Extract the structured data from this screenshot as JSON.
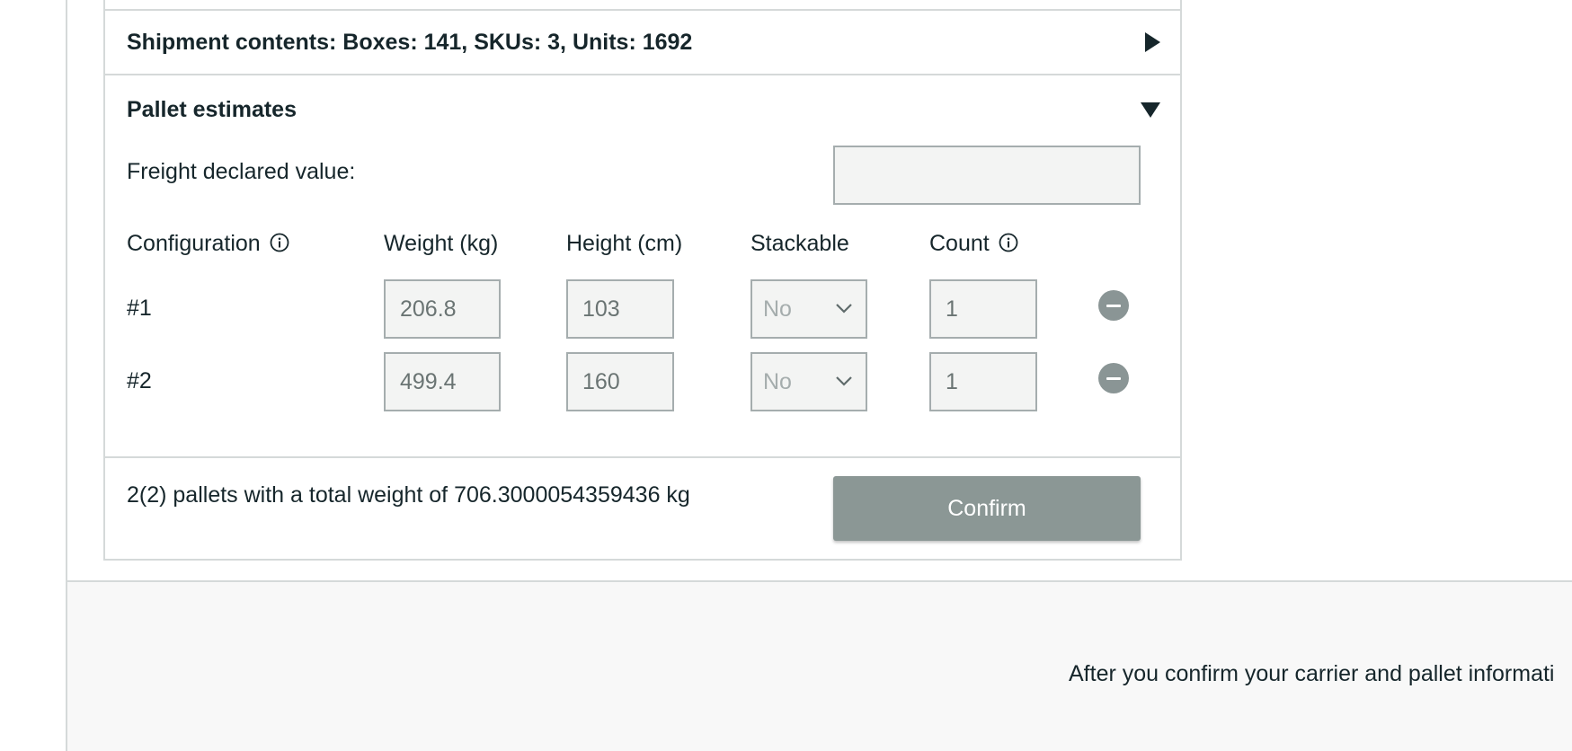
{
  "shipment_contents": {
    "title": "Shipment contents: Boxes: 141, SKUs: 3, Units: 1692",
    "expanded": false
  },
  "pallet_estimates": {
    "title": "Pallet estimates",
    "expanded": true,
    "freight_label": "Freight declared value:",
    "freight_value": "",
    "columns": {
      "configuration": "Configuration",
      "weight": "Weight (kg)",
      "height": "Height (cm)",
      "stackable": "Stackable",
      "count": "Count"
    },
    "rows": [
      {
        "label": "#1",
        "weight": "206.8",
        "height": "103",
        "stackable": "No",
        "count": "1"
      },
      {
        "label": "#2",
        "weight": "499.4",
        "height": "160",
        "stackable": "No",
        "count": "1"
      }
    ],
    "summary": "2(2) pallets with a total weight of 706.3000054359436 kg",
    "confirm_label": "Confirm"
  },
  "footer": {
    "text": "After you confirm your carrier and pallet informati"
  },
  "icons": {
    "info": "info-circle-icon",
    "remove": "minus-circle-icon",
    "collapsed": "triangle-right-icon",
    "expanded": "triangle-down-icon",
    "dropdown": "chevron-down-icon"
  },
  "colors": {
    "text": "#16262b",
    "border": "#d5d9d9",
    "field_bg": "#f3f4f3",
    "button_bg": "#8b9795",
    "footer_bg": "#f8f8f8"
  }
}
